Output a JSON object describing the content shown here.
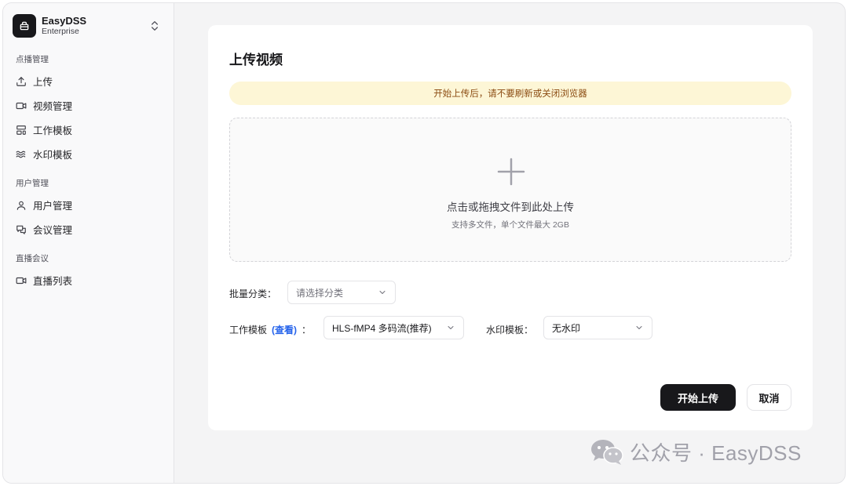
{
  "brand": {
    "name": "EasyDSS",
    "edition": "Enterprise"
  },
  "sidebar": {
    "groups": [
      {
        "label": "点播管理",
        "items": [
          {
            "label": "上传",
            "icon": "upload-icon"
          },
          {
            "label": "视频管理",
            "icon": "video-icon"
          },
          {
            "label": "工作模板",
            "icon": "layout-template-icon"
          },
          {
            "label": "水印模板",
            "icon": "waves-icon"
          }
        ]
      },
      {
        "label": "用户管理",
        "items": [
          {
            "label": "用户管理",
            "icon": "user-icon"
          },
          {
            "label": "会议管理",
            "icon": "messages-icon"
          }
        ]
      },
      {
        "label": "直播会议",
        "items": [
          {
            "label": "直播列表",
            "icon": "video-icon"
          }
        ]
      }
    ]
  },
  "page": {
    "title": "上传视频",
    "warning": "开始上传后，请不要刷新或关闭浏览器",
    "dropzone": {
      "title": "点击或拖拽文件到此处上传",
      "subtitle": "支持多文件，单个文件最大 2GB"
    },
    "batch_category": {
      "label": "批量分类：",
      "placeholder": "请选择分类"
    },
    "work_template": {
      "label": "工作模板",
      "link": "(查看)",
      "colon": "：",
      "value": "HLS-fMP4 多码流(推荐)"
    },
    "watermark_template": {
      "label": "水印模板：",
      "value": "无水印"
    },
    "actions": {
      "start": "开始上传",
      "cancel": "取消"
    }
  },
  "watermark_overlay": {
    "text": "公众号 · EasyDSS",
    "icon": "wechat-icon"
  },
  "colors": {
    "primary": "#18181b",
    "warning_bg": "#fdf6d6",
    "warning_text": "#8a4a10",
    "link": "#2563eb"
  }
}
